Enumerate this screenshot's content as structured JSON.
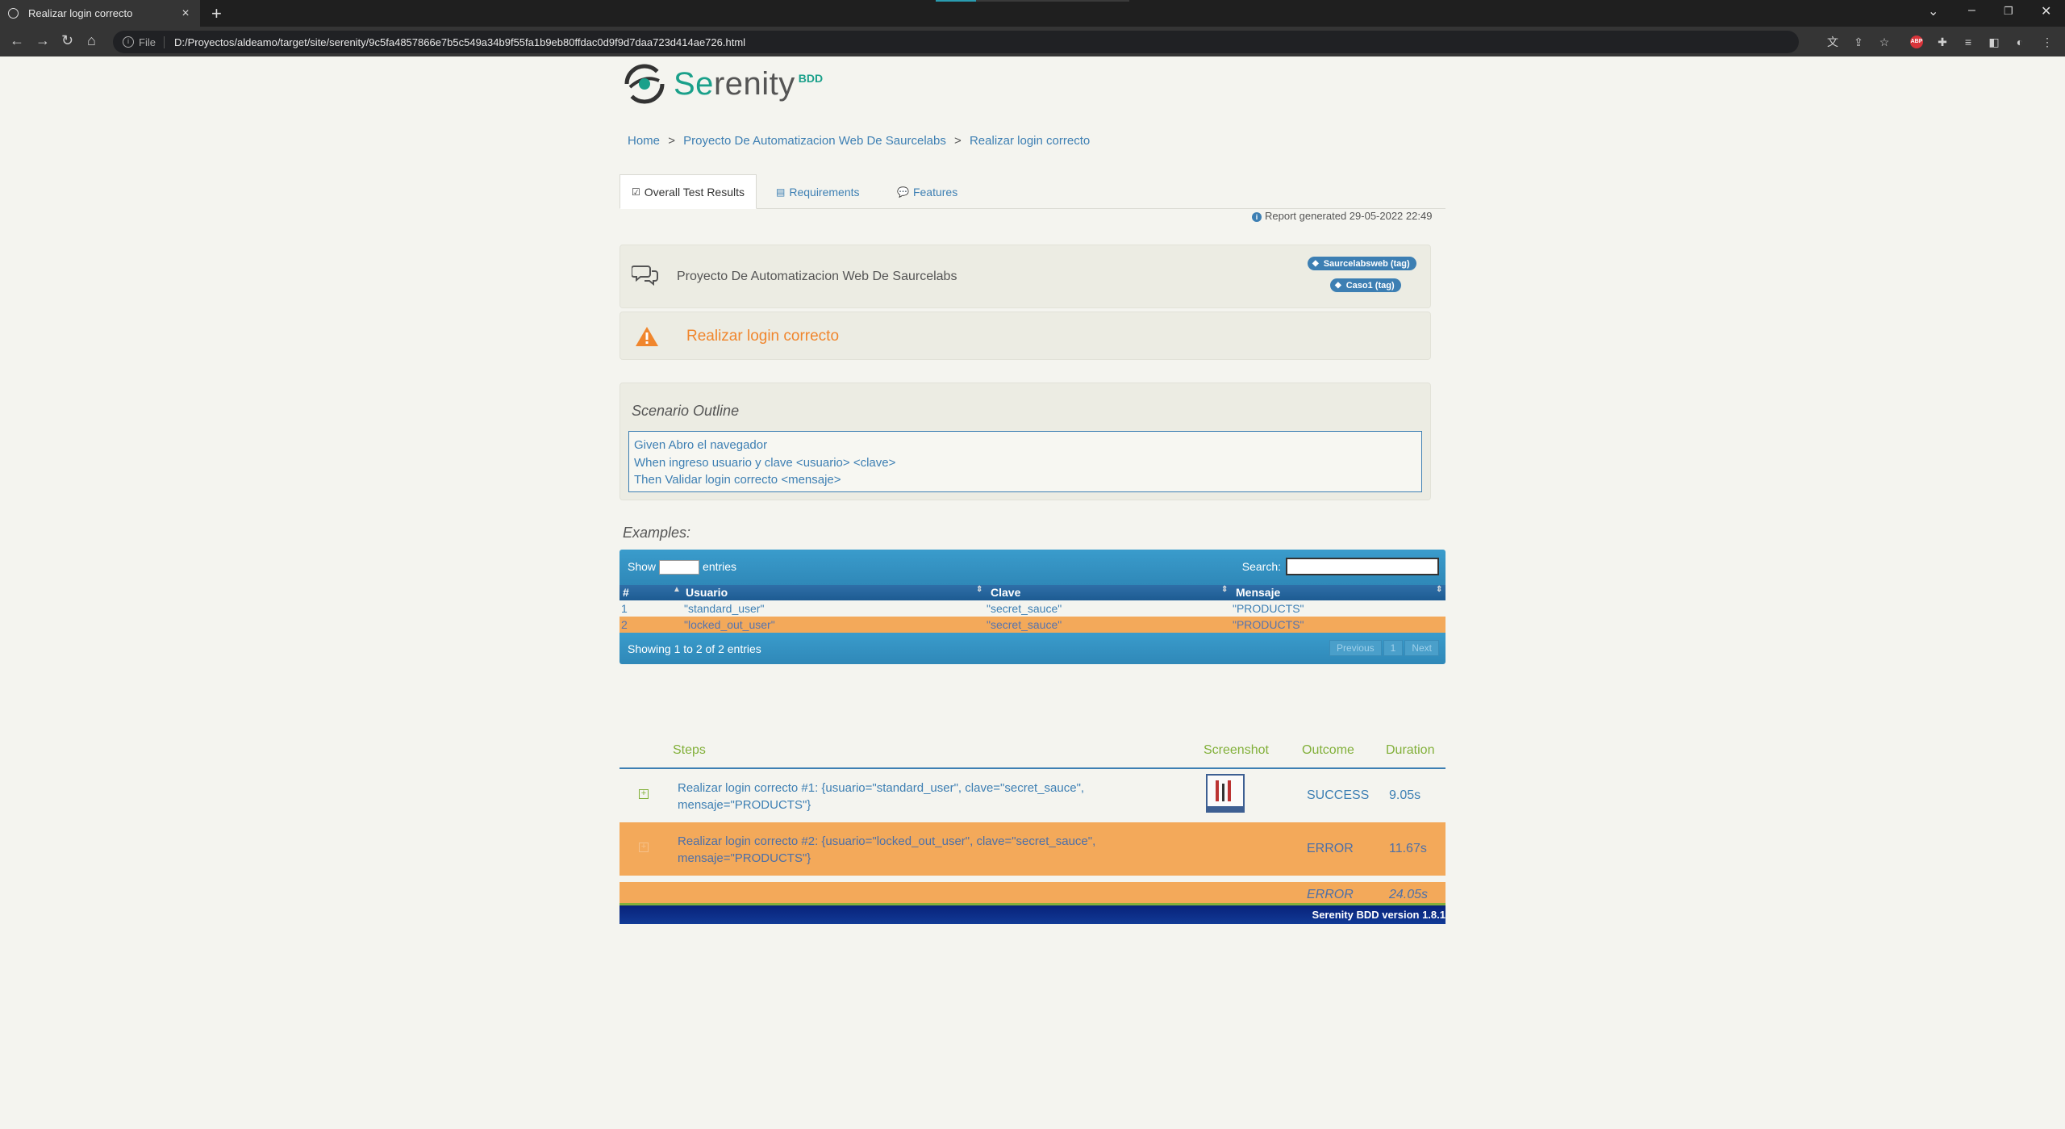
{
  "browser": {
    "tab_title": "Realizar login correcto",
    "url_scheme": "File",
    "url": "D:/Proyectos/aldeamo/target/site/serenity/9c5fa4857866e7b5c549a34b9f55fa1b9eb80ffdac0d9f9d7daa723d414ae726.html"
  },
  "logo": {
    "se": "Se",
    "rest": "renity",
    "sub": "BDD"
  },
  "breadcrumb": {
    "home": "Home",
    "project": "Proyecto De Automatizacion Web De Saurcelabs",
    "current": "Realizar login correcto",
    "sep": ">"
  },
  "tabs": {
    "overall": "Overall Test Results",
    "requirements": "Requirements",
    "features": "Features"
  },
  "report_generated": "Report generated 29-05-2022 22:49",
  "feature": {
    "title": "Proyecto De Automatizacion Web De Saurcelabs",
    "tags": [
      "Saurcelabsweb (tag)",
      "Caso1 (tag)"
    ]
  },
  "scenario": {
    "title": "Realizar login correcto"
  },
  "outline": {
    "heading": "Scenario Outline",
    "lines": [
      "Given Abro el navegador",
      "When ingreso usuario y clave <usuario> <clave>",
      "Then Validar login correcto <mensaje>"
    ]
  },
  "examples": {
    "heading": "Examples:",
    "show": "Show",
    "entries": "entries",
    "search": "Search:",
    "columns": [
      "#",
      "Usuario",
      "Clave",
      "Mensaje"
    ],
    "rows": [
      [
        "1",
        "\"standard_user\"",
        "\"secret_sauce\"",
        "\"PRODUCTS\""
      ],
      [
        "2",
        "\"locked_out_user\"",
        "\"secret_sauce\"",
        "\"PRODUCTS\""
      ]
    ],
    "info": "Showing 1 to 2 of 2 entries",
    "previous": "Previous",
    "page": "1",
    "next": "Next"
  },
  "steps": {
    "headers": {
      "steps": "Steps",
      "screenshot": "Screenshot",
      "outcome": "Outcome",
      "duration": "Duration"
    },
    "rows": [
      {
        "description": "Realizar login correcto #1: {usuario=\"standard_user\", clave=\"secret_sauce\", mensaje=\"PRODUCTS\"}",
        "outcome": "SUCCESS",
        "duration": "9.05s"
      },
      {
        "description": "Realizar login correcto #2: {usuario=\"locked_out_user\", clave=\"secret_sauce\", mensaje=\"PRODUCTS\"}",
        "outcome": "ERROR",
        "duration": "11.67s"
      }
    ],
    "total": {
      "outcome": "ERROR",
      "duration": "24.05s"
    }
  },
  "footer": {
    "version": "Serenity BDD version 1.8.1"
  },
  "colors": {
    "success": "#82b03a",
    "error": "#f3a95a",
    "link": "#3d7fb3",
    "pending": "#f0862d"
  }
}
